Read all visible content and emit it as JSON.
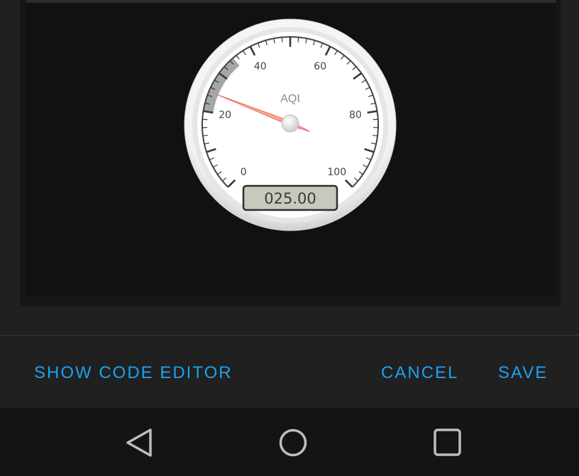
{
  "gauge": {
    "title": "AQI",
    "value": 25,
    "display_value": "025.00",
    "min": 0,
    "max": 100,
    "major_ticks": [
      "0",
      "20",
      "40",
      "60",
      "80",
      "100"
    ],
    "highlight_range": [
      20,
      35
    ],
    "colors": {
      "needle": "#e8574d",
      "needle_tail": "#f4a98c",
      "highlight": "#a6a6a6",
      "face": "#ffffff",
      "lcd_bg": "#c8c8bf"
    }
  },
  "actions": {
    "show_code_editor": "SHOW CODE EDITOR",
    "cancel": "CANCEL",
    "save": "SAVE",
    "accent_color": "#1ea0ee"
  },
  "navbar": {
    "back_icon": "back-triangle-icon",
    "home_icon": "home-circle-icon",
    "recents_icon": "recents-square-icon"
  }
}
